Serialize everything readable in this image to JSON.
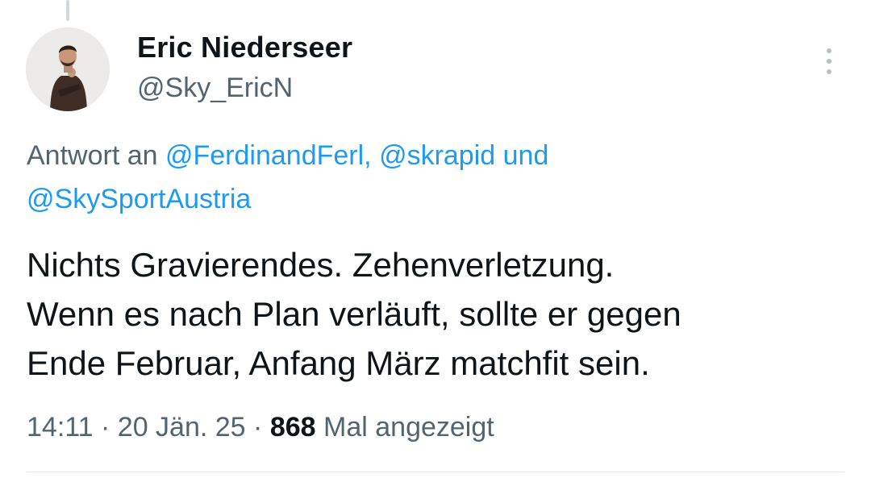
{
  "author": {
    "display_name": "Eric Niederseer",
    "handle": "@Sky_EricN"
  },
  "reply": {
    "prefix": "Antwort an",
    "mention_1": "@FerdinandFerl,",
    "mention_2": "@skrapid",
    "conjunction": "und",
    "mention_3": "@SkySportAustria"
  },
  "tweet": {
    "line_1": "Nichts Gravierendes. Zehenverletzung.",
    "line_2": "Wenn es nach Plan verläuft, sollte er gegen",
    "line_3": "Ende Februar, Anfang März matchfit sein."
  },
  "meta": {
    "time": "14:11",
    "separator": "·",
    "date": "20 Jän. 25",
    "views_count": "868",
    "views_label": "Mal angezeigt"
  },
  "colors": {
    "text": "#0f1419",
    "secondary": "#536471",
    "link": "#1d9bf0"
  },
  "icons": {
    "more": "more-vertical-icon"
  }
}
